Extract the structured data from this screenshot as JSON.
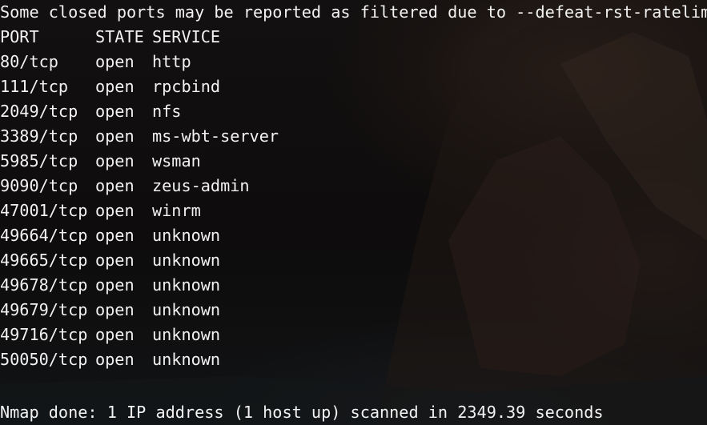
{
  "terminal": {
    "warning_line": "Some closed ports may be reported as filtered due to --defeat-rst-ratelimit",
    "table": {
      "headers": {
        "port": "PORT",
        "state": "STATE",
        "service": "SERVICE"
      },
      "rows": [
        {
          "port": "80/tcp",
          "state": "open",
          "service": "http"
        },
        {
          "port": "111/tcp",
          "state": "open",
          "service": "rpcbind"
        },
        {
          "port": "2049/tcp",
          "state": "open",
          "service": "nfs"
        },
        {
          "port": "3389/tcp",
          "state": "open",
          "service": "ms-wbt-server"
        },
        {
          "port": "5985/tcp",
          "state": "open",
          "service": "wsman"
        },
        {
          "port": "9090/tcp",
          "state": "open",
          "service": "zeus-admin"
        },
        {
          "port": "47001/tcp",
          "state": "open",
          "service": "winrm"
        },
        {
          "port": "49664/tcp",
          "state": "open",
          "service": "unknown"
        },
        {
          "port": "49665/tcp",
          "state": "open",
          "service": "unknown"
        },
        {
          "port": "49678/tcp",
          "state": "open",
          "service": "unknown"
        },
        {
          "port": "49679/tcp",
          "state": "open",
          "service": "unknown"
        },
        {
          "port": "49716/tcp",
          "state": "open",
          "service": "unknown"
        },
        {
          "port": "50050/tcp",
          "state": "open",
          "service": "unknown"
        }
      ]
    },
    "summary_line": "Nmap done: 1 IP address (1 host up) scanned in 2349.39 seconds"
  },
  "colors": {
    "text": "#f2f2f2",
    "background": "#0d0b0b"
  }
}
